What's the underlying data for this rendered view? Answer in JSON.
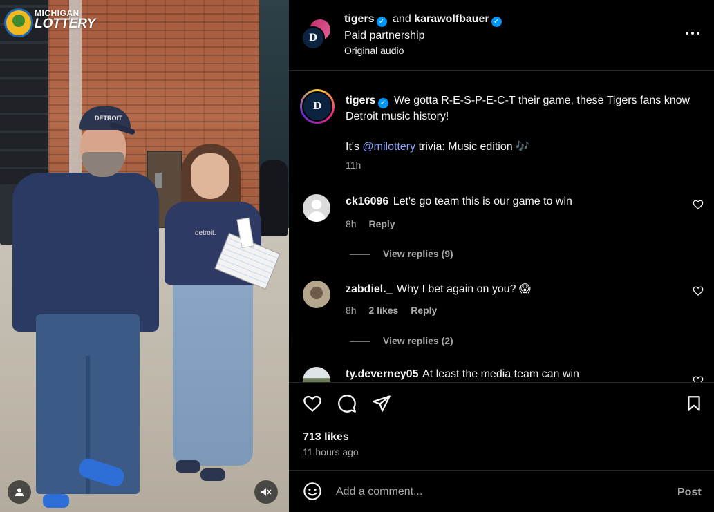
{
  "media": {
    "brand_logo": {
      "line1": "MICHIGAN",
      "line2": "LOTTERY"
    },
    "cap_text": "DETROIT",
    "shirt_text": "detroit.",
    "user_icon": "user-icon",
    "mute_icon": "speaker-muted-icon"
  },
  "header": {
    "author1": "tigers",
    "and_text": "and",
    "author2": "karawolfbauer",
    "partnership": "Paid partnership",
    "audio": "Original audio",
    "avatar_letter": "D"
  },
  "caption": {
    "username": "tigers",
    "text": "We gotta R-E-S-P-E-C-T their game, these Tigers fans know Detroit music history!",
    "line2_prefix": "It's",
    "mention": "@milottery",
    "line2_suffix": "trivia: Music edition",
    "emoji": "🎶",
    "time": "11h"
  },
  "comments": [
    {
      "username": "ck16096",
      "text": "Let's go team this is our game to win",
      "time": "8h",
      "likes": "",
      "reply": "Reply",
      "view_replies": "View replies (9)"
    },
    {
      "username": "zabdiel._",
      "text": "Why I bet again on you?",
      "emoji": "😱",
      "time": "8h",
      "likes": "2 likes",
      "reply": "Reply",
      "view_replies": "View replies (2)"
    },
    {
      "username": "ty.deverney05",
      "text": "At least the media team can win"
    }
  ],
  "stats": {
    "likes": "713 likes",
    "ago": "11 hours ago"
  },
  "composer": {
    "placeholder": "Add a comment...",
    "post": "Post"
  },
  "colors": {
    "verified": "#0095f6",
    "mention": "#8aa7ff",
    "background": "#000000",
    "muted_text": "#a8a8a8"
  }
}
